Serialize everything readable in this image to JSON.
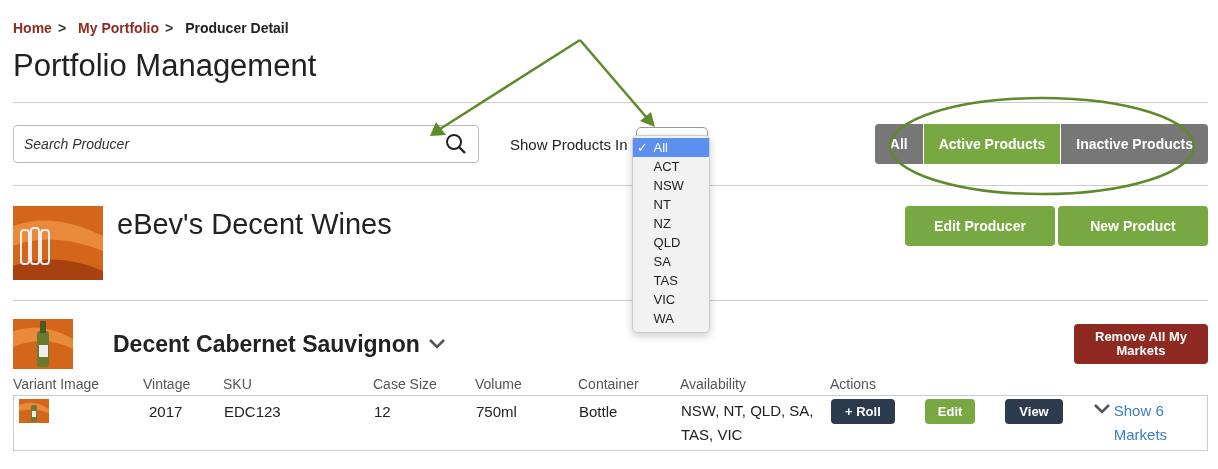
{
  "breadcrumb": [
    {
      "label": "Home",
      "suffix": ">",
      "kind": "link"
    },
    {
      "label": "My Portfolio",
      "suffix": ">",
      "kind": "link"
    },
    {
      "label": "Producer Detail",
      "kind": "current"
    }
  ],
  "title": "Portfolio Management",
  "search": {
    "placeholder": "Search Producer"
  },
  "filter": {
    "label": "Show Products In",
    "check": "✓",
    "options": [
      {
        "label": "All",
        "selected": true
      },
      {
        "label": "ACT",
        "selected": false
      },
      {
        "label": "NSW",
        "selected": false
      },
      {
        "label": "NT",
        "selected": false
      },
      {
        "label": "NZ",
        "selected": false
      },
      {
        "label": "QLD",
        "selected": false
      },
      {
        "label": "SA",
        "selected": false
      },
      {
        "label": "TAS",
        "selected": false
      },
      {
        "label": "VIC",
        "selected": false
      },
      {
        "label": "WA",
        "selected": false
      }
    ]
  },
  "tabs": [
    {
      "label": "All",
      "selected": false
    },
    {
      "label": "Active Products",
      "selected": true
    },
    {
      "label": "Inactive Products",
      "selected": false
    }
  ],
  "producer": {
    "name": "eBev's Decent Wines",
    "buttons": [
      "Edit Producer",
      "New Product"
    ]
  },
  "product": {
    "name": "Decent Cabernet Sauvignon",
    "remove_button": "Remove All My Markets",
    "table": {
      "columns": [
        "Variant Image",
        "Vintage",
        "SKU",
        "Case Size",
        "Volume",
        "Container",
        "Availability",
        "Actions"
      ],
      "rows": [
        {
          "vintage": "2017",
          "sku": "EDC123",
          "case_size": "12",
          "volume": "750ml",
          "container": "Bottle",
          "availability": "NSW, NT, QLD, SA, TAS, VIC",
          "actions": [
            {
              "label": "+ Roll",
              "kind": "dark"
            },
            {
              "label": "Edit",
              "kind": "green"
            },
            {
              "label": "View",
              "kind": "dark"
            }
          ],
          "markets_link": "Show 6 Markets"
        }
      ]
    }
  }
}
